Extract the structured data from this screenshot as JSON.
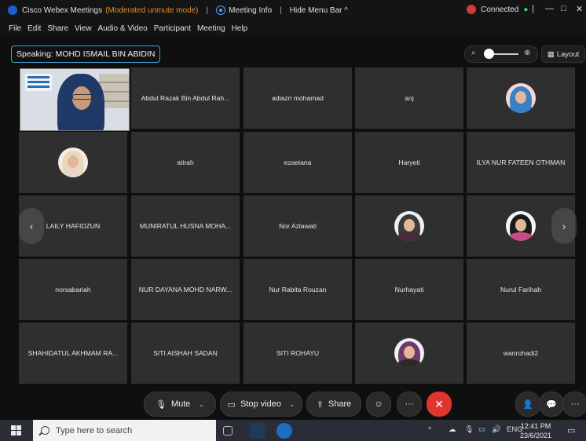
{
  "titlebar": {
    "app_title": "Cisco Webex Meetings",
    "mode": "(Moderated unmute mode)",
    "meeting_info": "Meeting Info",
    "hide_menu": "Hide Menu Bar ^",
    "connected": "Connected",
    "connected_dot": "●",
    "separator": "|",
    "minimize": "—",
    "maximize": "□",
    "close": "✕"
  },
  "menu": [
    "File",
    "Edit",
    "Share",
    "View",
    "Audio & Video",
    "Participant",
    "Meeting",
    "Help"
  ],
  "speaking": "Speaking: MOHD ISMAIL BIN ABIDIN",
  "zoom": {
    "out_icon": "search-minus-icon",
    "in_icon": "search-plus-icon"
  },
  "layout_label": "Layout",
  "participants": [
    {
      "name": "MOHD ISMAIL BIN ABIDIN",
      "kind": "video"
    },
    {
      "name": "Abdul Razak Bin Abdul Rah...",
      "kind": "name"
    },
    {
      "name": "adiazri mohamad",
      "kind": "name"
    },
    {
      "name": "anj",
      "kind": "name"
    },
    {
      "name": "",
      "kind": "avatar",
      "hijab": "#3a7fc8",
      "body": "#3a7fc8",
      "bg": "#f1d7d2"
    },
    {
      "name": "",
      "kind": "avatar",
      "hijab": "#ead7c0",
      "body": "#e6d8c6",
      "bg": "#f6ece2"
    },
    {
      "name": "atirah",
      "kind": "name"
    },
    {
      "name": "ezaeiana",
      "kind": "name"
    },
    {
      "name": "Haryeti",
      "kind": "name"
    },
    {
      "name": "ILYA NUR FATEEN OTHMAN",
      "kind": "name"
    },
    {
      "name": "LAILY HAFIDZUN",
      "kind": "name"
    },
    {
      "name": "MUNIRATUL HUSNA MOHA...",
      "kind": "name"
    },
    {
      "name": "Nor Azlawati",
      "kind": "name"
    },
    {
      "name": "",
      "kind": "avatar",
      "hijab": "#3a3a3a",
      "body": "#4a2a3a",
      "bg": "#efefef"
    },
    {
      "name": "",
      "kind": "avatar",
      "hijab": "#1a1a1a",
      "body": "#c94c8a",
      "bg": "#f5f5f5"
    },
    {
      "name": "norsabariah",
      "kind": "name"
    },
    {
      "name": "NUR DAYANA MOHD NARW...",
      "kind": "name"
    },
    {
      "name": "Nur Rabita Rouzan",
      "kind": "name"
    },
    {
      "name": "Nurhayati",
      "kind": "name"
    },
    {
      "name": "Nurul Farihah",
      "kind": "name"
    },
    {
      "name": "SHAHIDATUL AKHMAM RA...",
      "kind": "name"
    },
    {
      "name": "SITI AISHAH SADAN",
      "kind": "name"
    },
    {
      "name": "SITI ROHAYU",
      "kind": "name"
    },
    {
      "name": "",
      "kind": "avatar",
      "hijab": "#6b3b6b",
      "body": "#2a2a2a",
      "bg": "#efefef"
    },
    {
      "name": "wanrohadi2",
      "kind": "name"
    }
  ],
  "nav": {
    "prev": "‹",
    "next": "›"
  },
  "controls": {
    "mute": "Mute",
    "stop_video": "Stop video",
    "share": "Share",
    "more": "···",
    "end": "✕",
    "caret": "⌄"
  },
  "taskbar": {
    "search_placeholder": "Type here to search",
    "lang": "ENG",
    "time": "12:41 PM",
    "date": "23/6/2021",
    "tray_up": "^"
  },
  "colors": {
    "accent": "#3aa7d6",
    "end": "#e0342f",
    "mode": "#e58a2a",
    "tile": "#2f2f2f"
  }
}
